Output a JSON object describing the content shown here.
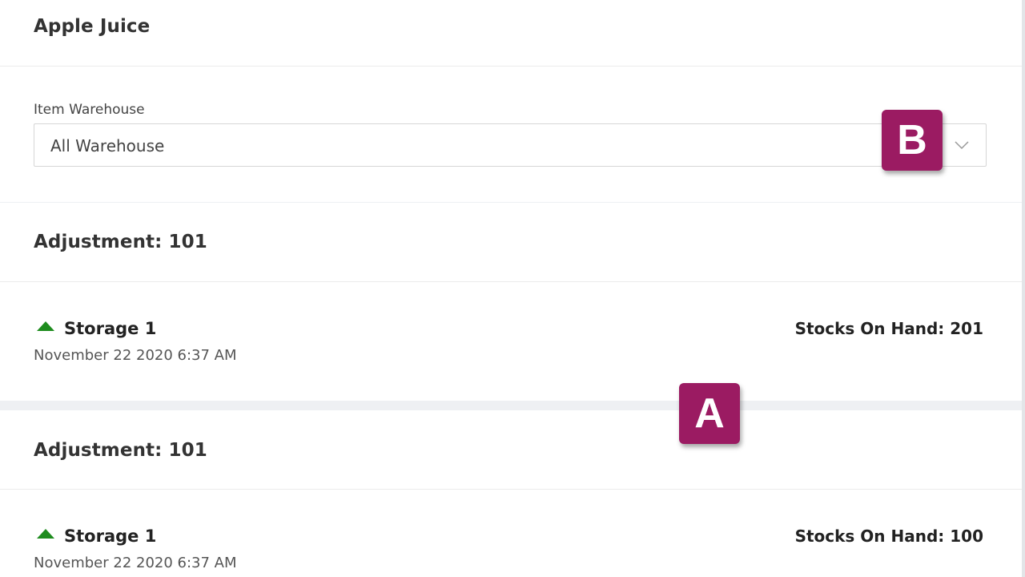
{
  "page": {
    "title": "Apple Juice"
  },
  "filter": {
    "label": "Item Warehouse",
    "selected": "All Warehouse"
  },
  "adjustments": [
    {
      "heading": "Adjustment: 101",
      "location": "Storage 1",
      "date": "November 22 2020 6:37 AM",
      "stocks": "Stocks On Hand: 201",
      "direction": "up"
    },
    {
      "heading": "Adjustment: 101",
      "location": "Storage 1",
      "date": "November 22 2020 6:37 AM",
      "stocks": "Stocks On Hand: 100",
      "direction": "up"
    }
  ],
  "callouts": {
    "a": "A",
    "b": "B"
  },
  "colors": {
    "badge": "#9b1b62",
    "up_arrow": "#1e8c1e"
  },
  "icons": {
    "dropdown": "chevron-down-icon",
    "direction": "triangle-up-icon"
  }
}
